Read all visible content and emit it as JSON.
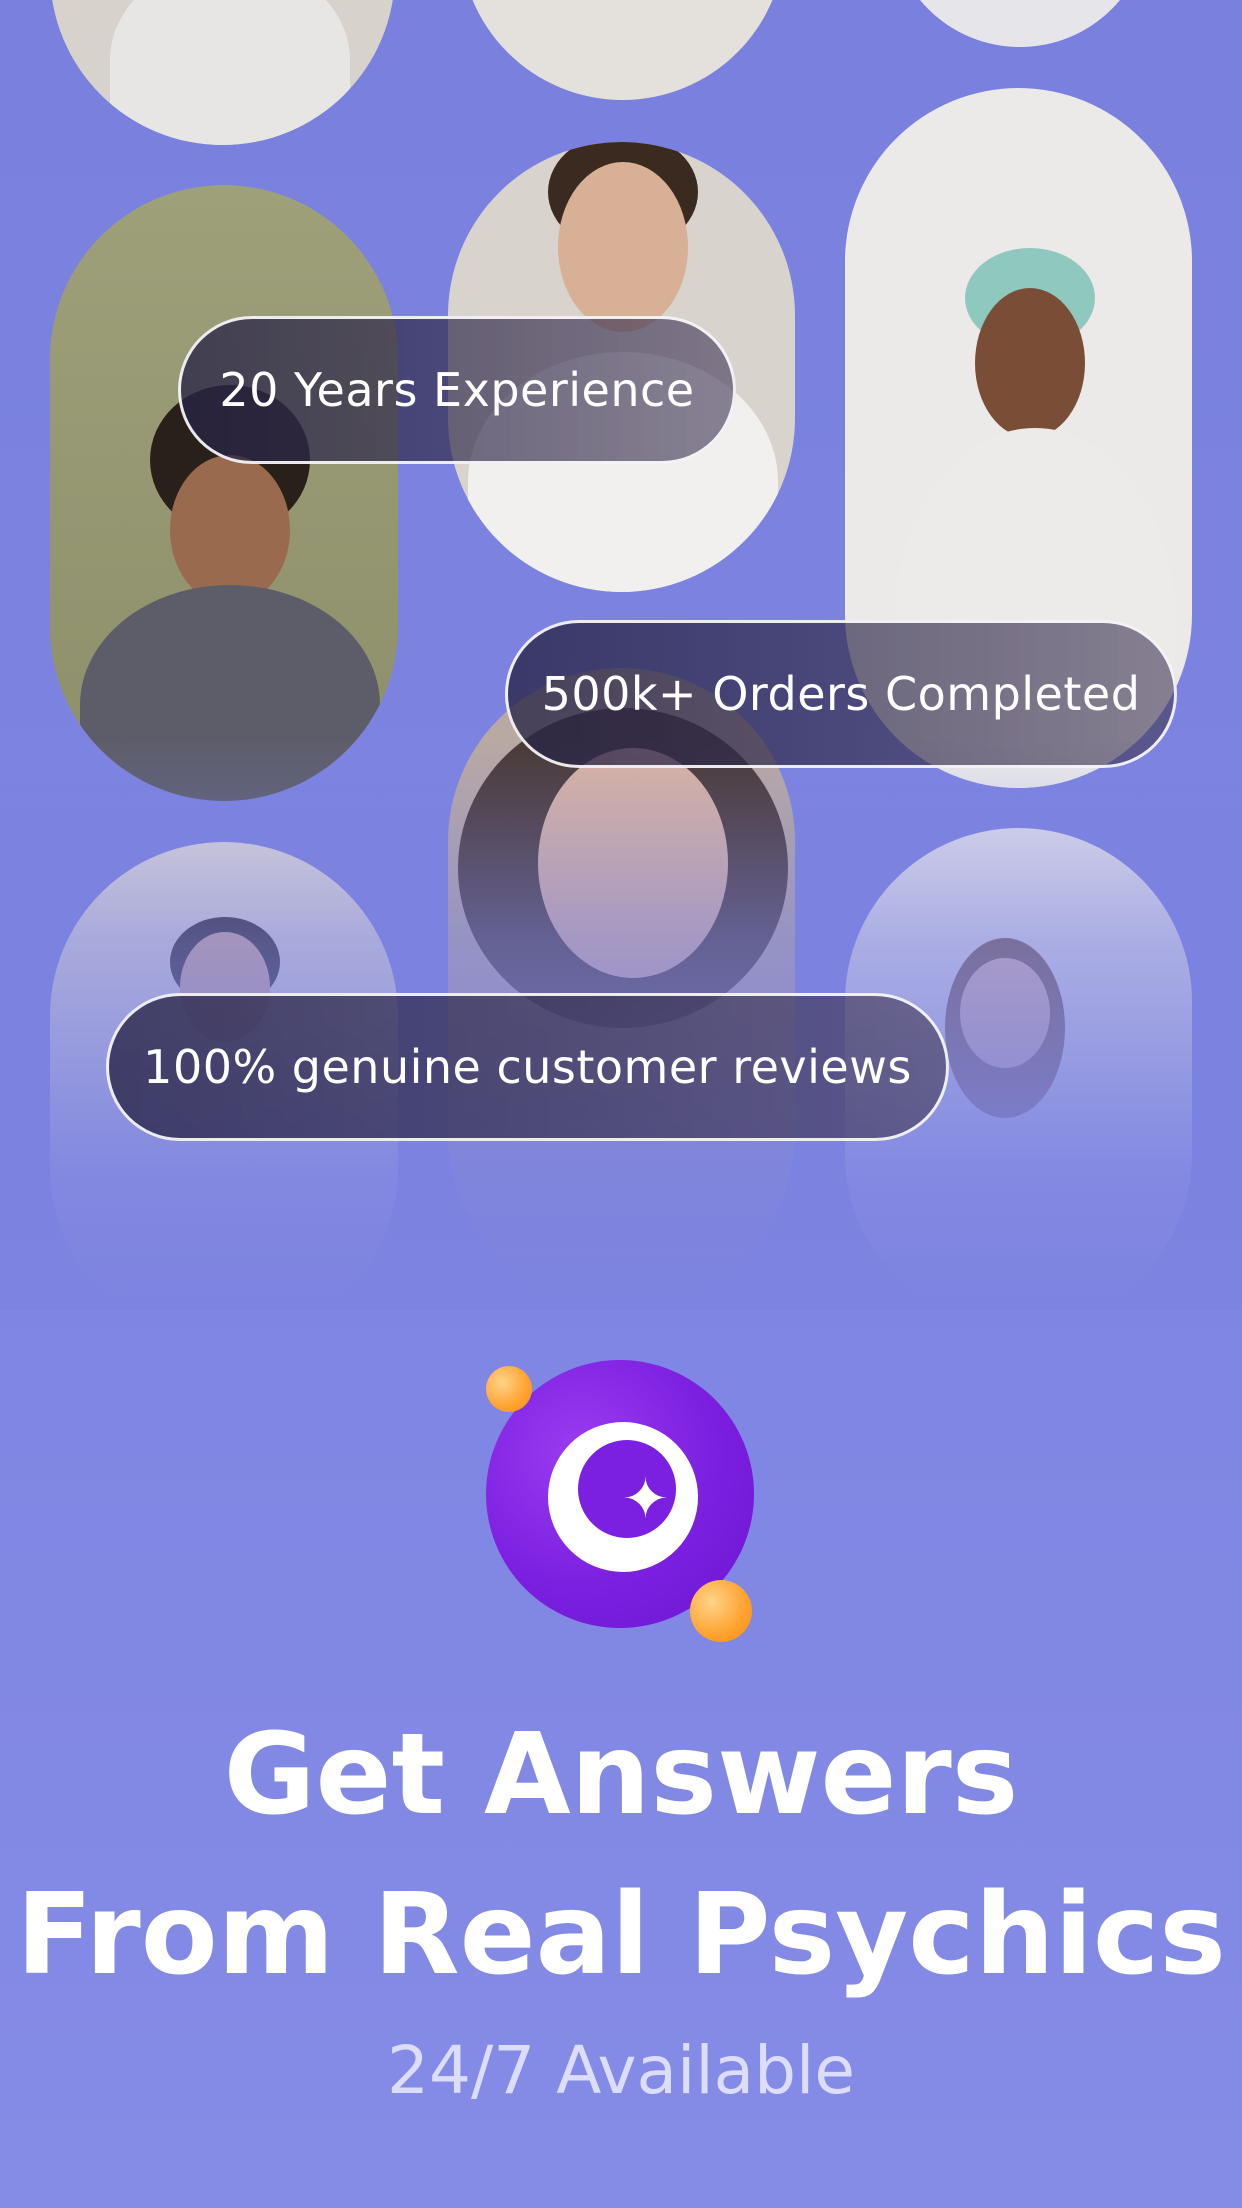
{
  "badges": {
    "experience": "20 Years Experience",
    "orders": "500k+ Orders Completed",
    "reviews": "100% genuine customer reviews"
  },
  "headline": {
    "line1": "Get Answers",
    "line2": "From Real Psychics"
  },
  "subtitle": "24/7 Available",
  "logo": {
    "icon": "crescent-moon-star-icon"
  },
  "colors": {
    "background": "#7980de",
    "logo_purple": "#7b1fe0",
    "orb_orange": "#ffa22e",
    "text": "#ffffff"
  }
}
